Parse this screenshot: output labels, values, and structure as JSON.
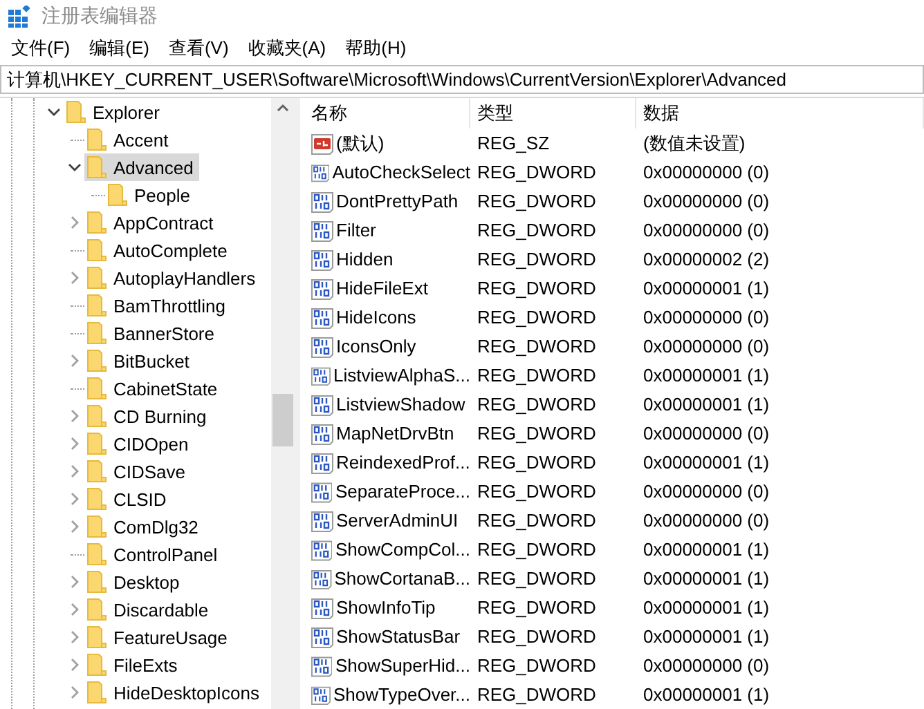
{
  "window": {
    "title": "注册表编辑器"
  },
  "menu": [
    "文件(F)",
    "编辑(E)",
    "查看(V)",
    "收藏夹(A)",
    "帮助(H)"
  ],
  "address": "计算机\\HKEY_CURRENT_USER\\Software\\Microsoft\\Windows\\CurrentVersion\\Explorer\\Advanced",
  "tree": [
    {
      "label": "Explorer",
      "expanded": true,
      "selected": false,
      "has_subkeys": true,
      "children": [
        {
          "label": "Accent",
          "selected": false,
          "has_subkeys": false
        },
        {
          "label": "Advanced",
          "expanded": true,
          "selected": true,
          "has_subkeys": true,
          "children": [
            {
              "label": "People",
              "selected": false,
              "has_subkeys": false
            }
          ]
        },
        {
          "label": "AppContract",
          "expanded": false,
          "selected": false,
          "has_subkeys": true
        },
        {
          "label": "AutoComplete",
          "selected": false,
          "has_subkeys": false
        },
        {
          "label": "AutoplayHandlers",
          "expanded": false,
          "selected": false,
          "has_subkeys": true
        },
        {
          "label": "BamThrottling",
          "selected": false,
          "has_subkeys": false
        },
        {
          "label": "BannerStore",
          "selected": false,
          "has_subkeys": false
        },
        {
          "label": "BitBucket",
          "expanded": false,
          "selected": false,
          "has_subkeys": true
        },
        {
          "label": "CabinetState",
          "selected": false,
          "has_subkeys": false
        },
        {
          "label": "CD Burning",
          "expanded": false,
          "selected": false,
          "has_subkeys": true
        },
        {
          "label": "CIDOpen",
          "expanded": false,
          "selected": false,
          "has_subkeys": true
        },
        {
          "label": "CIDSave",
          "expanded": false,
          "selected": false,
          "has_subkeys": true
        },
        {
          "label": "CLSID",
          "expanded": false,
          "selected": false,
          "has_subkeys": true
        },
        {
          "label": "ComDlg32",
          "expanded": false,
          "selected": false,
          "has_subkeys": true
        },
        {
          "label": "ControlPanel",
          "selected": false,
          "has_subkeys": false
        },
        {
          "label": "Desktop",
          "expanded": false,
          "selected": false,
          "has_subkeys": true
        },
        {
          "label": "Discardable",
          "expanded": false,
          "selected": false,
          "has_subkeys": true
        },
        {
          "label": "FeatureUsage",
          "expanded": false,
          "selected": false,
          "has_subkeys": true
        },
        {
          "label": "FileExts",
          "expanded": false,
          "selected": false,
          "has_subkeys": true
        },
        {
          "label": "HideDesktopIcons",
          "expanded": false,
          "selected": false,
          "has_subkeys": true
        }
      ]
    }
  ],
  "table": {
    "columns": [
      "名称",
      "类型",
      "数据"
    ],
    "rows": [
      {
        "kind": "string",
        "name": "(默认)",
        "type": "REG_SZ",
        "data": "(数值未设置)"
      },
      {
        "kind": "dword",
        "name": "AutoCheckSelect",
        "type": "REG_DWORD",
        "data": "0x00000000 (0)"
      },
      {
        "kind": "dword",
        "name": "DontPrettyPath",
        "type": "REG_DWORD",
        "data": "0x00000000 (0)"
      },
      {
        "kind": "dword",
        "name": "Filter",
        "type": "REG_DWORD",
        "data": "0x00000000 (0)"
      },
      {
        "kind": "dword",
        "name": "Hidden",
        "type": "REG_DWORD",
        "data": "0x00000002 (2)"
      },
      {
        "kind": "dword",
        "name": "HideFileExt",
        "type": "REG_DWORD",
        "data": "0x00000001 (1)"
      },
      {
        "kind": "dword",
        "name": "HideIcons",
        "type": "REG_DWORD",
        "data": "0x00000000 (0)"
      },
      {
        "kind": "dword",
        "name": "IconsOnly",
        "type": "REG_DWORD",
        "data": "0x00000000 (0)"
      },
      {
        "kind": "dword",
        "name": "ListviewAlphaS...",
        "type": "REG_DWORD",
        "data": "0x00000001 (1)"
      },
      {
        "kind": "dword",
        "name": "ListviewShadow",
        "type": "REG_DWORD",
        "data": "0x00000001 (1)"
      },
      {
        "kind": "dword",
        "name": "MapNetDrvBtn",
        "type": "REG_DWORD",
        "data": "0x00000000 (0)"
      },
      {
        "kind": "dword",
        "name": "ReindexedProf...",
        "type": "REG_DWORD",
        "data": "0x00000001 (1)"
      },
      {
        "kind": "dword",
        "name": "SeparateProce...",
        "type": "REG_DWORD",
        "data": "0x00000000 (0)"
      },
      {
        "kind": "dword",
        "name": "ServerAdminUI",
        "type": "REG_DWORD",
        "data": "0x00000000 (0)"
      },
      {
        "kind": "dword",
        "name": "ShowCompCol...",
        "type": "REG_DWORD",
        "data": "0x00000001 (1)"
      },
      {
        "kind": "dword",
        "name": "ShowCortanaB...",
        "type": "REG_DWORD",
        "data": "0x00000001 (1)"
      },
      {
        "kind": "dword",
        "name": "ShowInfoTip",
        "type": "REG_DWORD",
        "data": "0x00000001 (1)"
      },
      {
        "kind": "dword",
        "name": "ShowStatusBar",
        "type": "REG_DWORD",
        "data": "0x00000001 (1)"
      },
      {
        "kind": "dword",
        "name": "ShowSuperHid...",
        "type": "REG_DWORD",
        "data": "0x00000000 (0)"
      },
      {
        "kind": "dword",
        "name": "ShowTypeOver...",
        "type": "REG_DWORD",
        "data": "0x00000001 (1)"
      }
    ]
  }
}
